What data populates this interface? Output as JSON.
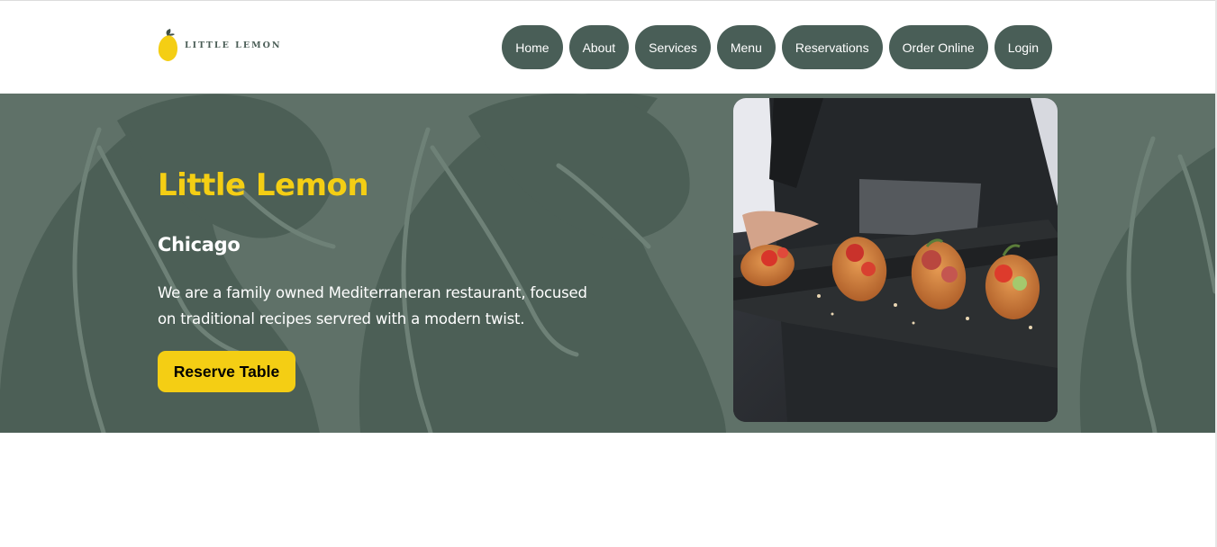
{
  "nav": {
    "logo_text": "LITTLE LEMON",
    "links": [
      "Home",
      "About",
      "Services",
      "Menu",
      "Reservations",
      "Order Online",
      "Login"
    ]
  },
  "hero": {
    "title": "Little Lemon",
    "subtitle": "Chicago",
    "description": "We are a family owned Mediterraneran restaurant, focused on traditional recipes servred with a modern twist.",
    "cta_label": "Reserve Table",
    "image": "chef-serving-bruschetta-on-slate-board"
  },
  "colors": {
    "primary_green": "#495e57",
    "hero_background": "#5f7168",
    "accent_yellow": "#f4ce14",
    "white": "#ffffff"
  },
  "icons": {
    "logo": "lemon-icon"
  }
}
